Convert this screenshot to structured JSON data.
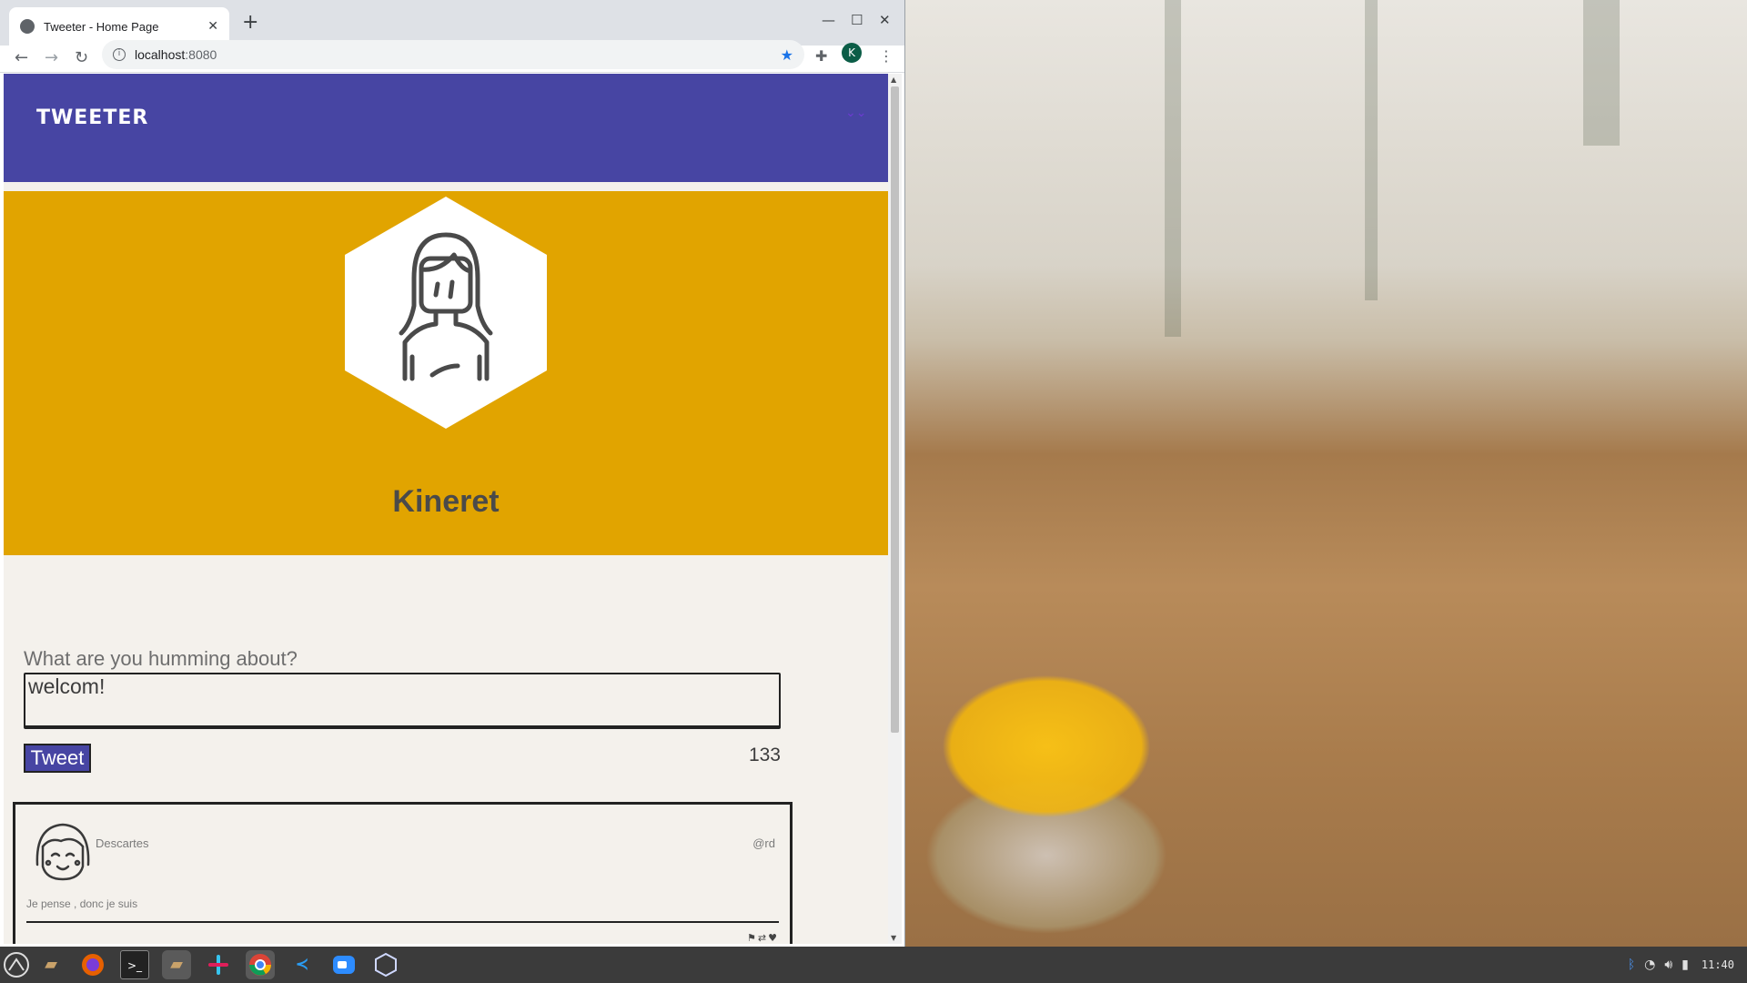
{
  "browser": {
    "tab_title": "Tweeter - Home Page",
    "url_host": "localhost",
    "url_port": ":8080",
    "profile_initial": "K"
  },
  "site": {
    "logo": "TWEETER",
    "nav_toggle_icon": "double-chevron-down-icon"
  },
  "profile": {
    "name": "Kineret",
    "avatar_icon": "woman-avatar-icon"
  },
  "compose": {
    "label": "What are you humming about?",
    "text_value": "welcom!",
    "button_label": "Tweet",
    "char_counter": "133"
  },
  "tweets": [
    {
      "author": "Descartes",
      "handle": "@rd",
      "content": "Je pense , donc je suis",
      "avatar_icon": "girl-avatar-icon",
      "actions_icons": [
        "flag-icon",
        "retweet-icon",
        "heart-icon"
      ]
    }
  ],
  "taskbar": {
    "apps": [
      "menu-icon",
      "files-icon",
      "firefox-icon",
      "terminal-icon",
      "folder-icon",
      "slack-icon",
      "chrome-icon",
      "vscode-icon",
      "zoom-icon",
      "virtualbox-icon"
    ],
    "clock": "11:40",
    "tray_icons": [
      "bluetooth-icon",
      "wifi-icon",
      "volume-icon",
      "battery-icon"
    ]
  },
  "colors": {
    "nav_bg": "#4745a3",
    "header_bg": "#e1a400",
    "page_bg": "#f4f1ec"
  }
}
